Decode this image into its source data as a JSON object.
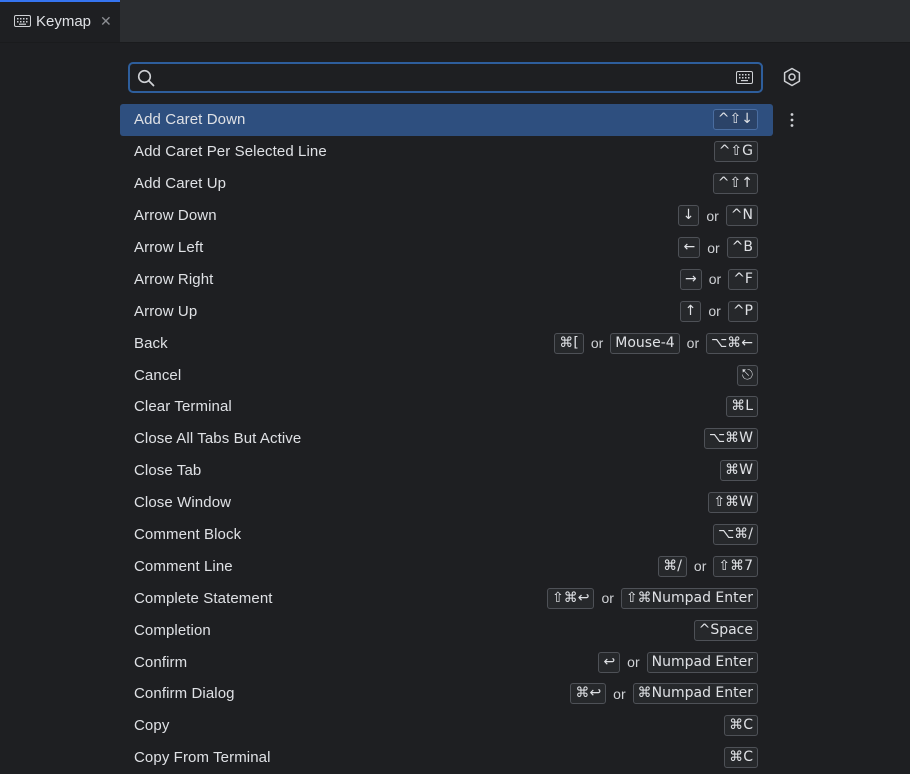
{
  "tab": {
    "label": "Keymap",
    "close": "✕"
  },
  "search": {
    "value": "",
    "placeholder": ""
  },
  "actions": [
    {
      "label": "Add Caret Down",
      "selected": true,
      "shortcuts": [
        "^⇧↓"
      ]
    },
    {
      "label": "Add Caret Per Selected Line",
      "shortcuts": [
        "^⇧G"
      ]
    },
    {
      "label": "Add Caret Up",
      "shortcuts": [
        "^⇧↑"
      ]
    },
    {
      "label": "Arrow Down",
      "shortcuts": [
        "↓",
        "^N"
      ]
    },
    {
      "label": "Arrow Left",
      "shortcuts": [
        "←",
        "^B"
      ]
    },
    {
      "label": "Arrow Right",
      "shortcuts": [
        "→",
        "^F"
      ]
    },
    {
      "label": "Arrow Up",
      "shortcuts": [
        "↑",
        "^P"
      ]
    },
    {
      "label": "Back",
      "shortcuts": [
        "⌘[",
        "Mouse-4",
        "⌥⌘←"
      ]
    },
    {
      "label": "Cancel",
      "shortcuts": [
        "⎋"
      ]
    },
    {
      "label": "Clear Terminal",
      "shortcuts": [
        "⌘L"
      ]
    },
    {
      "label": "Close All Tabs But Active",
      "shortcuts": [
        "⌥⌘W"
      ]
    },
    {
      "label": "Close Tab",
      "shortcuts": [
        "⌘W"
      ]
    },
    {
      "label": "Close Window",
      "shortcuts": [
        "⇧⌘W"
      ]
    },
    {
      "label": "Comment Block",
      "shortcuts": [
        "⌥⌘/"
      ]
    },
    {
      "label": "Comment Line",
      "shortcuts": [
        "⌘/",
        "⇧⌘7"
      ]
    },
    {
      "label": "Complete Statement",
      "shortcuts": [
        "⇧⌘↩",
        "⇧⌘Numpad Enter"
      ]
    },
    {
      "label": "Completion",
      "shortcuts": [
        "^Space"
      ]
    },
    {
      "label": "Confirm",
      "shortcuts": [
        "↩",
        "Numpad Enter"
      ]
    },
    {
      "label": "Confirm Dialog",
      "shortcuts": [
        "⌘↩",
        "⌘Numpad Enter"
      ]
    },
    {
      "label": "Copy",
      "shortcuts": [
        "⌘C"
      ]
    },
    {
      "label": "Copy From Terminal",
      "shortcuts": [
        "⌘C"
      ]
    }
  ],
  "separator": "or",
  "colors": {
    "accent": "#3574f0",
    "selection": "#2e4f7f",
    "background": "#1e1f22"
  }
}
